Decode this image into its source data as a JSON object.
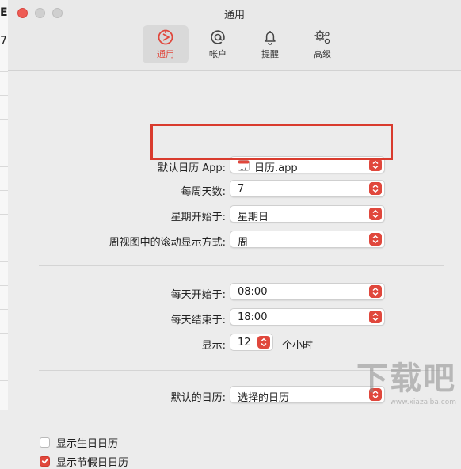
{
  "window": {
    "title": "通用"
  },
  "background_app": {
    "glyph_1": "E",
    "glyph_2": "7"
  },
  "toolbar": {
    "items": [
      {
        "label": "通用",
        "icon": "general-icon",
        "active": true
      },
      {
        "label": "帐户",
        "icon": "at-sign-icon",
        "active": false
      },
      {
        "label": "提醒",
        "icon": "bell-icon",
        "active": false
      },
      {
        "label": "高级",
        "icon": "gears-icon",
        "active": false
      }
    ]
  },
  "settings": {
    "default_app": {
      "label": "默认日历 App:",
      "value": "日历.app",
      "icon": "calendar-app-icon"
    },
    "days_per_week": {
      "label": "每周天数:",
      "value": "7"
    },
    "week_start": {
      "label": "星期开始于:",
      "value": "星期日"
    },
    "week_view_scroll": {
      "label": "周视图中的滚动显示方式:",
      "value": "周"
    },
    "day_start": {
      "label": "每天开始于:",
      "value": "08:00"
    },
    "day_end": {
      "label": "每天结束于:",
      "value": "18:00"
    },
    "show_hours": {
      "label": "显示:",
      "value": "12",
      "unit": "个小时"
    },
    "default_calendar": {
      "label": "默认的日历:",
      "value": "选择的日历"
    }
  },
  "checkboxes": [
    {
      "label": "显示生日日历",
      "checked": false
    },
    {
      "label": "显示节假日日历",
      "checked": true
    }
  ],
  "accent_color": "#e0473c",
  "highlight_color": "#d93b2e",
  "watermark": {
    "text": "下载吧",
    "sub": "www.xiazaiba.com"
  }
}
